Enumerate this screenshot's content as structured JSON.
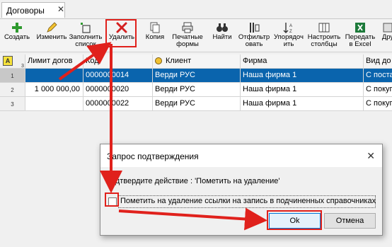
{
  "tab": {
    "label": "Договоры",
    "close": "✕"
  },
  "toolbar": {
    "buttons": [
      {
        "label": "Создать"
      },
      {
        "label": "Изменить"
      },
      {
        "label": "Заполнить список"
      },
      {
        "label": "Удалить"
      },
      {
        "label": "Копия"
      },
      {
        "label": "Печатные формы"
      },
      {
        "label": "Найти"
      },
      {
        "label": "Отфильтр овать"
      },
      {
        "label": "Упорядоч ить"
      },
      {
        "label": "Настроить столбцы"
      },
      {
        "label": "Передать в Excel"
      },
      {
        "label": "Дру"
      }
    ]
  },
  "grid": {
    "corner_letter": "A",
    "corner_num": "3",
    "columns": [
      "Лимит догов",
      "Код",
      "Клиент",
      "Фирма",
      "Вид до"
    ],
    "rows": [
      {
        "num": "1",
        "limit": "",
        "code": "0000000014",
        "client": "Верди РУС",
        "firm": "Наша фирма 1",
        "kind": "С постав"
      },
      {
        "num": "2",
        "limit": "1 000 000,00",
        "code": "0000000020",
        "client": "Верди РУС",
        "firm": "Наша фирма 1",
        "kind": "С покуп"
      },
      {
        "num": "3",
        "limit": "",
        "code": "0000000022",
        "client": "Верди РУС",
        "firm": "Наша фирма 1",
        "kind": "С покуп"
      }
    ]
  },
  "dialog": {
    "title": "Запрос подтверждения",
    "close": "✕",
    "message": "Подтвердите действие : 'Пометить на удаление'",
    "checkbox_label": "Пометить на удаление ссылки на запись в подчиненных справочниках",
    "ok_label": "Ok",
    "cancel_label": "Отмена"
  },
  "colors": {
    "annotation": "#e0211c",
    "selection": "#0a64ad"
  }
}
